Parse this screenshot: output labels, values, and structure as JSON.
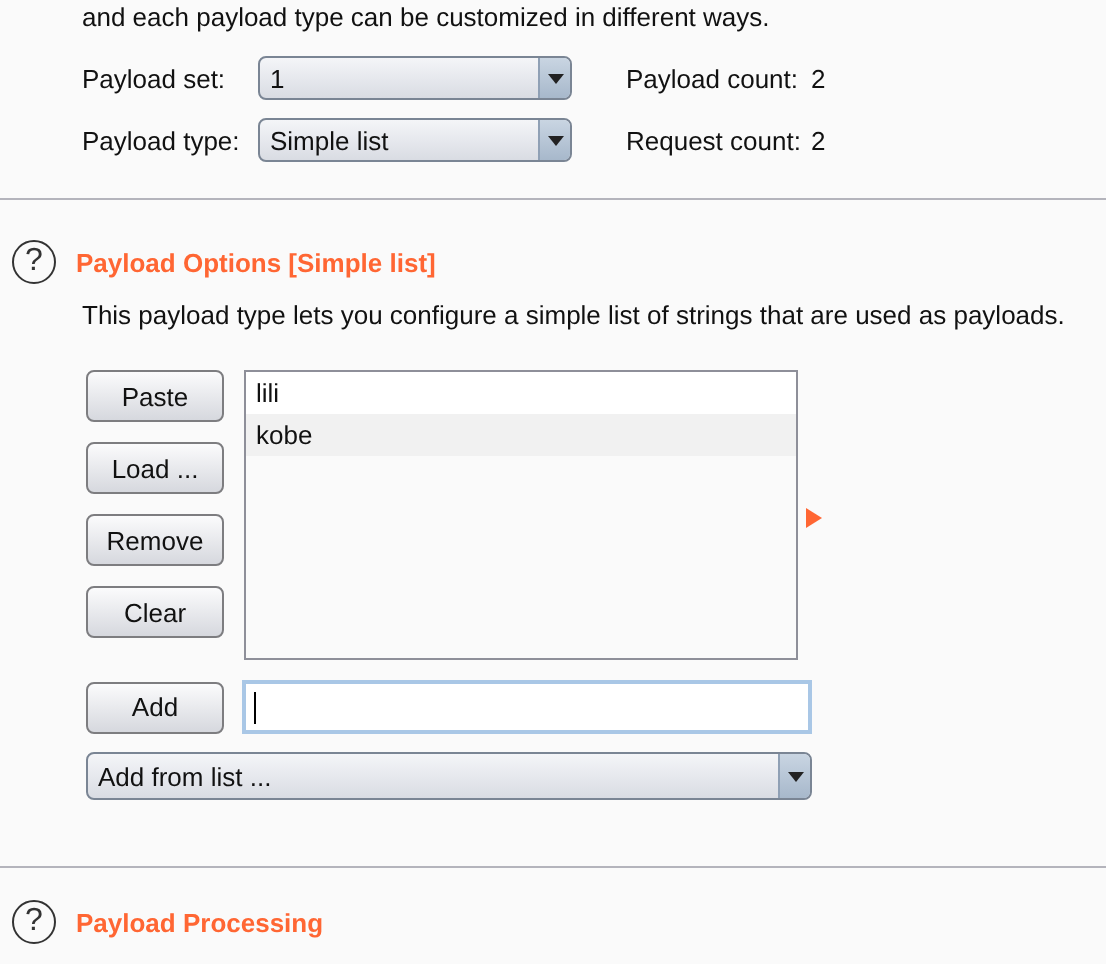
{
  "intro": "and each payload type can be customized in different ways.",
  "payload_set": {
    "label": "Payload set:",
    "value": "1"
  },
  "payload_type": {
    "label": "Payload type:",
    "value": "Simple list"
  },
  "payload_count": {
    "label": "Payload count:",
    "value": "2"
  },
  "request_count": {
    "label": "Request count:",
    "value": "2"
  },
  "options": {
    "help_icon": "?",
    "title": "Payload Options [Simple list]",
    "description": "This payload type lets you configure a simple list of strings that are used as payloads.",
    "buttons": [
      "Paste",
      "Load ...",
      "Remove",
      "Clear"
    ],
    "items": [
      {
        "text": "lili",
        "selected": false
      },
      {
        "text": "kobe",
        "selected": true
      }
    ],
    "add_button": "Add",
    "add_from_list": "Add from list ..."
  },
  "next_section": {
    "help_icon": "?",
    "title": "Payload Processing"
  }
}
